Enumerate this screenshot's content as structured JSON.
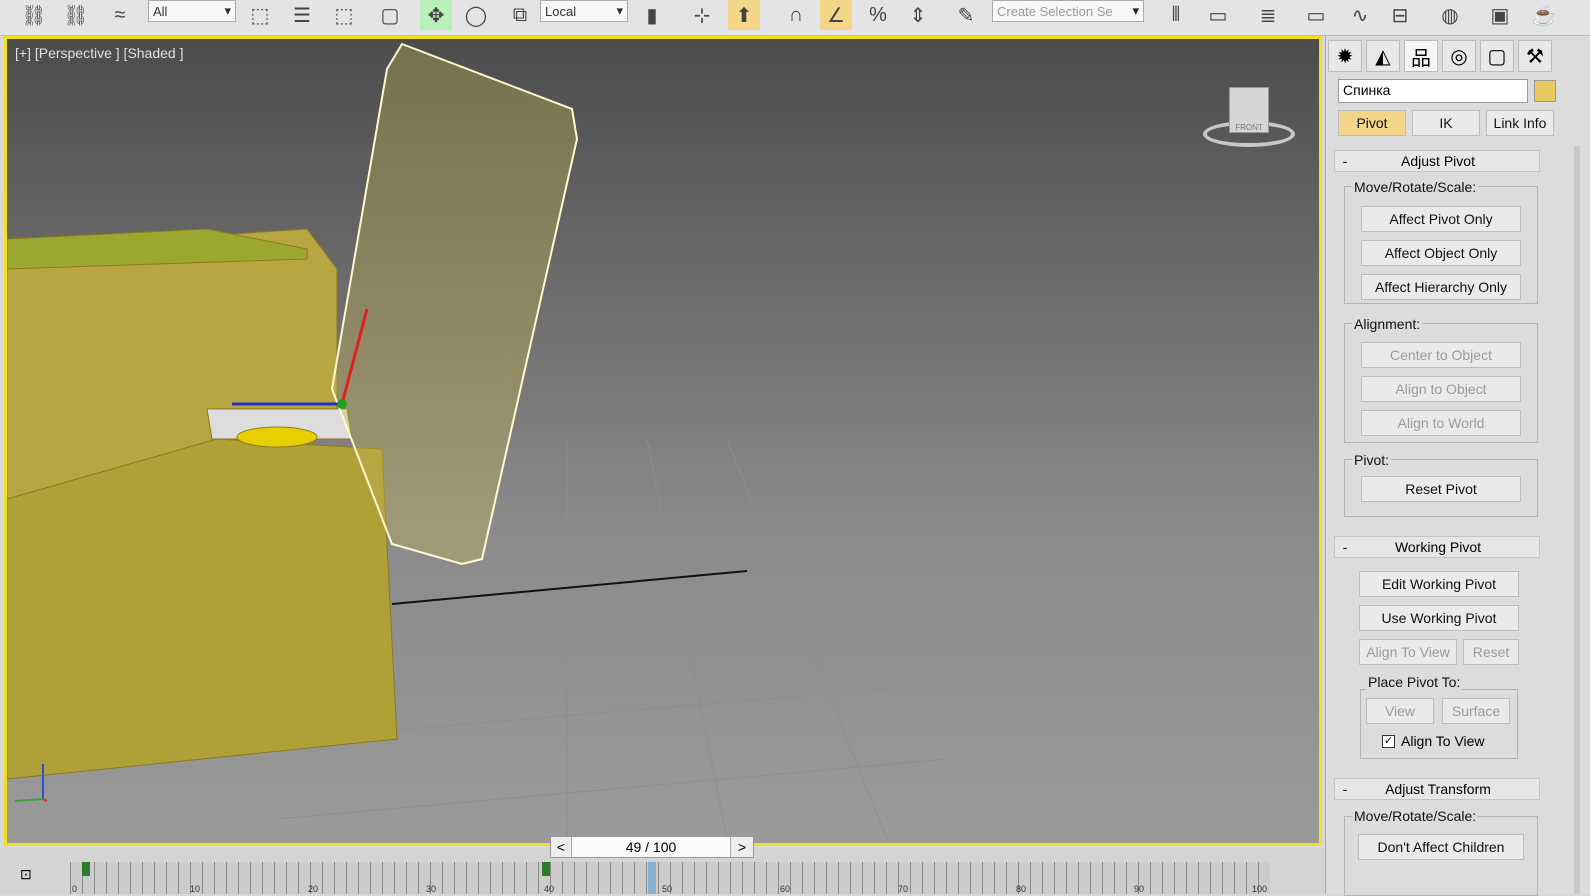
{
  "toolbar": {
    "selection_filter": "All",
    "coordinate_system": "Local",
    "named_selection_placeholder": "Create Selection Se",
    "icons": [
      "link-icon",
      "unlink-icon",
      "bind-space-warp-icon",
      "select-object-icon",
      "select-by-name-icon",
      "rect-selection-icon",
      "window-crossing-icon",
      "select-move-icon",
      "select-rotate-icon",
      "select-scale-icon",
      "pivot-center-icon",
      "select-manipulate-icon",
      "keyboard-shortcut-icon",
      "snap-3d-icon",
      "angle-snap-icon",
      "percent-snap-icon",
      "spinner-snap-icon",
      "edit-named-selection-icon",
      "mirror-icon",
      "align-icon",
      "layer-manager-icon",
      "scene-explorer-icon",
      "curve-editor-icon",
      "schematic-view-icon",
      "material-editor-icon",
      "render-setup-icon",
      "render-icon"
    ]
  },
  "viewport": {
    "label": "[+] [Perspective ] [Shaded ]",
    "viewcube": "FRONT"
  },
  "timeline": {
    "current": "49 / 100",
    "prev": "<",
    "next": ">",
    "ticks": [
      "0",
      "10",
      "20",
      "30",
      "40",
      "50",
      "60",
      "70",
      "80",
      "90",
      "100"
    ]
  },
  "panel": {
    "object_name": "Спинка",
    "object_color": "#e8c860",
    "tabs": [
      "Pivot",
      "IK",
      "Link Info"
    ],
    "adjust_pivot": {
      "title": "Adjust Pivot",
      "move_label": "Move/Rotate/Scale:",
      "buttons": [
        "Affect Pivot Only",
        "Affect Object Only",
        "Affect Hierarchy Only"
      ],
      "alignment_label": "Alignment:",
      "align_buttons": [
        "Center to Object",
        "Align to Object",
        "Align to World"
      ],
      "pivot_label": "Pivot:",
      "reset": "Reset Pivot"
    },
    "working_pivot": {
      "title": "Working Pivot",
      "edit": "Edit Working Pivot",
      "use": "Use Working Pivot",
      "align_view": "Align To View",
      "reset": "Reset",
      "place_label": "Place Pivot To:",
      "view": "View",
      "surface": "Surface",
      "align_check": "Align To View"
    },
    "adjust_transform": {
      "title": "Adjust Transform",
      "move_label": "Move/Rotate/Scale:",
      "dont_affect": "Don't Affect Children"
    },
    "collapse": "-"
  }
}
